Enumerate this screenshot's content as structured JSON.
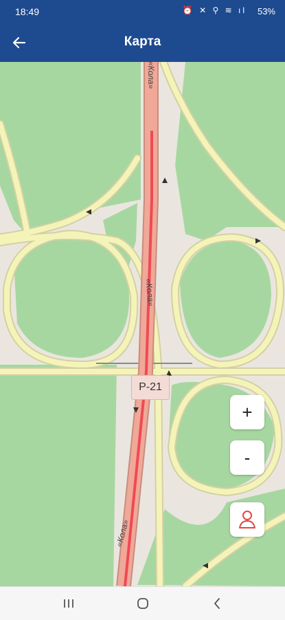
{
  "status_bar": {
    "time": "18:49",
    "icons": "⏰ ✕ ⚲ ≋ ıl",
    "battery": "53%"
  },
  "app_bar": {
    "title": "Карта",
    "back_icon": "arrow-left-icon"
  },
  "map": {
    "road_shield": "Р-21",
    "road_name_top": "«Кола»",
    "road_name_middle": "«Кола»",
    "road_name_bottom": "«Кола»",
    "colors": {
      "forest": "#a7d7a1",
      "road_casing": "#d5cfa4",
      "road_fill": "#f4f4b8",
      "trunk_casing": "#c98c7d",
      "trunk_fill": "#f0a898",
      "route": "#ef4a52",
      "background": "#eae6df"
    }
  },
  "controls": {
    "zoom_in_label": "+",
    "zoom_out_label": "-",
    "locate_icon": "person-location-icon"
  },
  "nav_bar": {
    "recents_icon": "recent-apps-icon",
    "home_icon": "home-icon",
    "back_icon": "back-chevron-icon"
  }
}
